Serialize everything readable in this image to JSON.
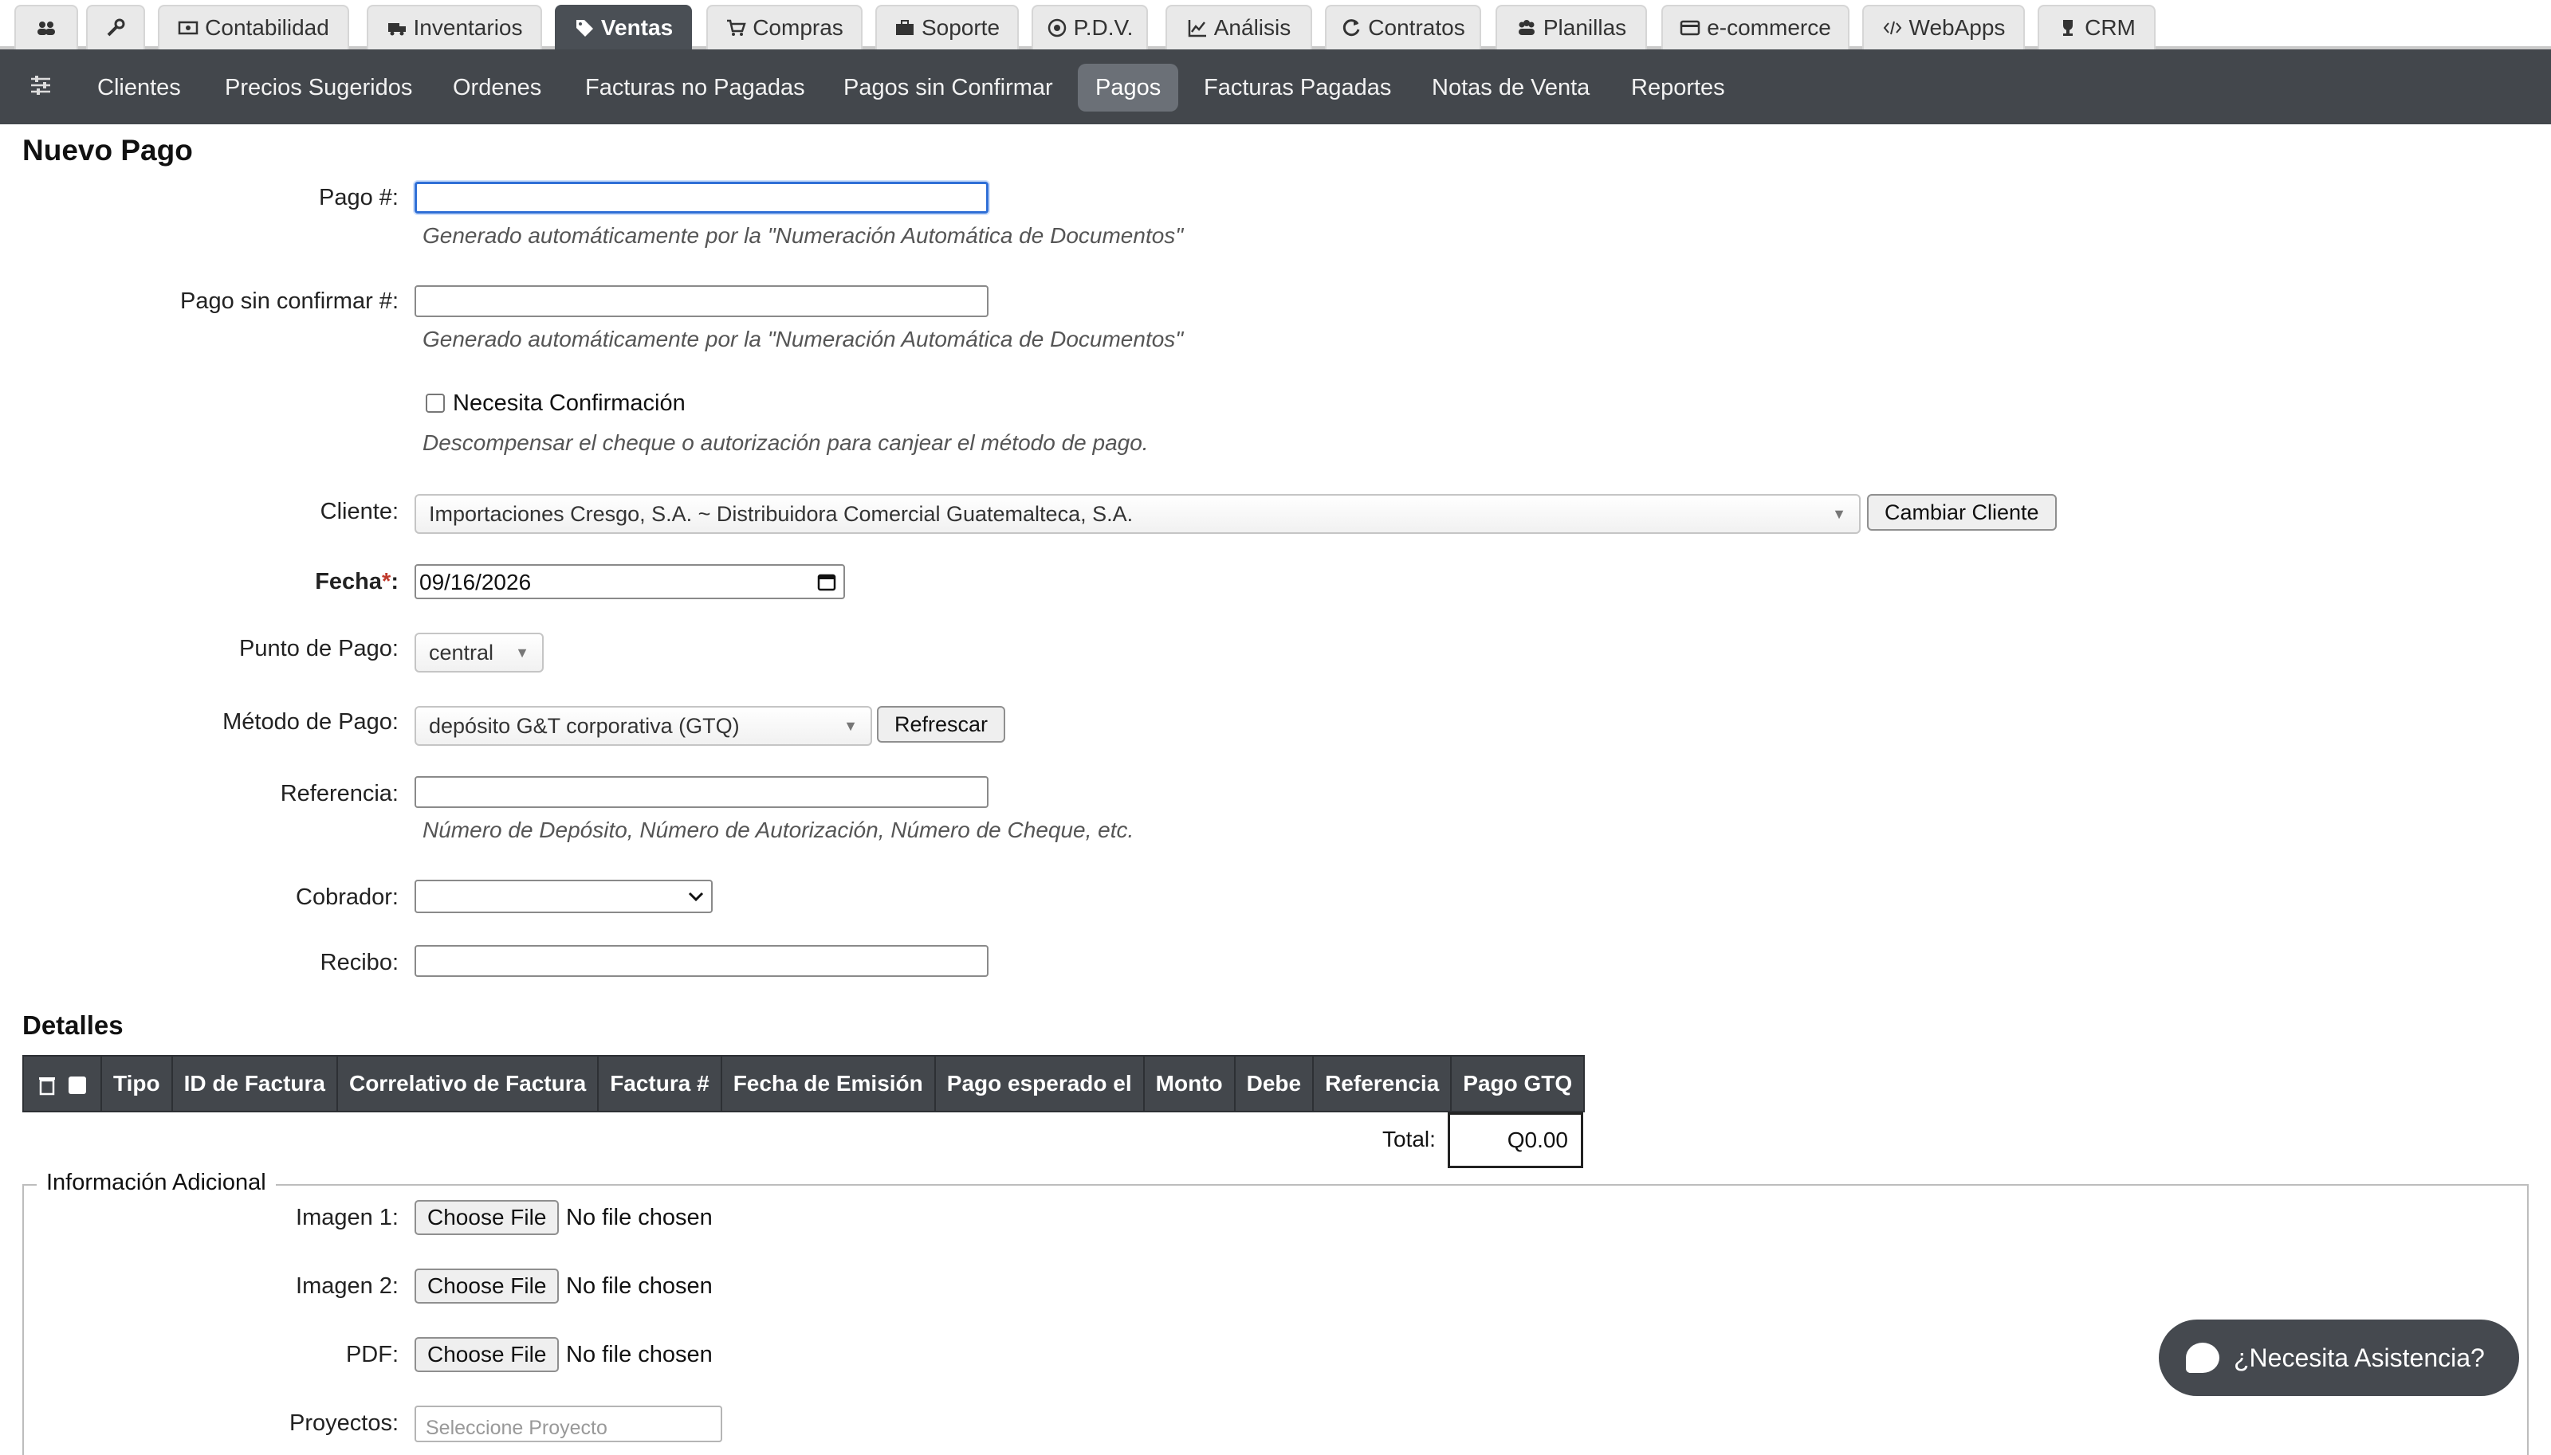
{
  "top_tabs": [
    {
      "label": "",
      "icon": "users-icon"
    },
    {
      "label": "",
      "icon": "wrench-icon"
    },
    {
      "label": "Contabilidad",
      "icon": "money-icon"
    },
    {
      "label": "Inventarios",
      "icon": "truck-icon"
    },
    {
      "label": "Ventas",
      "icon": "tags-icon",
      "active": true
    },
    {
      "label": "Compras",
      "icon": "cart-icon"
    },
    {
      "label": "Soporte",
      "icon": "briefcase-icon"
    },
    {
      "label": "P.D.V.",
      "icon": "target-icon"
    },
    {
      "label": "Análisis",
      "icon": "line-chart-icon"
    },
    {
      "label": "Contratos",
      "icon": "refresh-icon"
    },
    {
      "label": "Planillas",
      "icon": "group-icon"
    },
    {
      "label": "e-commerce",
      "icon": "credit-card-icon"
    },
    {
      "label": "WebApps",
      "icon": "code-icon"
    },
    {
      "label": "CRM",
      "icon": "trophy-icon"
    }
  ],
  "sub_nav": {
    "menu_icon": "sliders-icon",
    "items": [
      "Clientes",
      "Precios Sugeridos",
      "Ordenes",
      "Facturas no Pagadas",
      "Pagos sin Confirmar",
      "Pagos",
      "Facturas Pagadas",
      "Notas de Venta",
      "Reportes"
    ],
    "active": "Pagos"
  },
  "form": {
    "title": "Nuevo Pago",
    "pago_label": "Pago #:",
    "pago_value": "",
    "pago_hint": "Generado automáticamente por la \"Numeración Automática de Documentos\"",
    "pago_sin_confirmar_label": "Pago sin confirmar #:",
    "pago_sin_confirmar_value": "",
    "pago_sin_confirmar_hint": "Generado automáticamente por la \"Numeración Automática de Documentos\"",
    "necesita_confirmacion_label": "Necesita Confirmación",
    "necesita_confirmacion_checked": false,
    "necesita_confirmacion_hint": "Descompensar el cheque o autorización para canjear el método de pago.",
    "cliente_label": "Cliente:",
    "cliente_value": "Importaciones Cresgo, S.A. ~ Distribuidora Comercial Guatemalteca, S.A.",
    "cambiar_cliente_button": "Cambiar Cliente",
    "fecha_label": "Fecha",
    "fecha_required_mark": "*",
    "fecha_colon": ":",
    "fecha_value": "09/16/2026",
    "punto_pago_label": "Punto de Pago:",
    "punto_pago_value": "central",
    "metodo_pago_label": "Método de Pago:",
    "metodo_pago_value": "depósito G&T corporativa (GTQ)",
    "refrescar_button": "Refrescar",
    "referencia_label": "Referencia:",
    "referencia_value": "",
    "referencia_hint": "Número de Depósito, Número de Autorización, Número de Cheque, etc.",
    "cobrador_label": "Cobrador:",
    "cobrador_value": "",
    "recibo_label": "Recibo:",
    "recibo_value": ""
  },
  "detalles": {
    "title": "Detalles",
    "columns": [
      "Tipo",
      "ID de Factura",
      "Correlativo de Factura",
      "Factura #",
      "Fecha de Emisión",
      "Pago esperado el",
      "Monto",
      "Debe",
      "Referencia",
      "Pago GTQ"
    ],
    "total_label": "Total:",
    "total_value": "Q0.00"
  },
  "info_adicional": {
    "legend": "Información Adicional",
    "imagen1_label": "Imagen 1:",
    "imagen2_label": "Imagen 2:",
    "pdf_label": "PDF:",
    "choose_file": "Choose File",
    "no_file": "No file chosen",
    "proyectos_label": "Proyectos:",
    "proyectos_placeholder": "Seleccione Proyecto"
  },
  "assist_button": "¿Necesita Asistencia?",
  "colors": {
    "nav_bg": "#43474c",
    "active_tab": "#4a4f55",
    "focus": "#2f6fd6"
  }
}
